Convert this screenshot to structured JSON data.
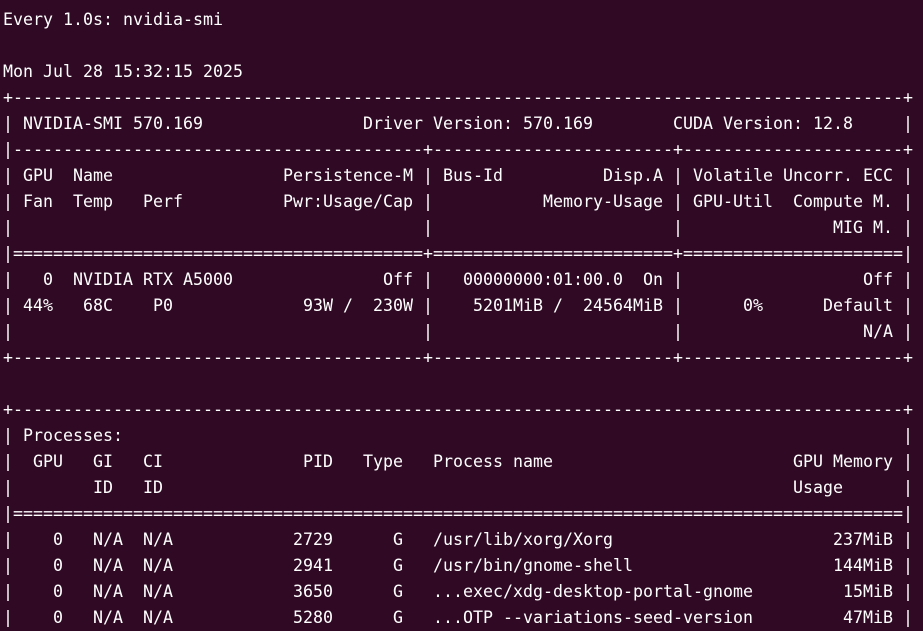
{
  "window": {
    "background": "#300a24",
    "foreground": "#ffffff"
  },
  "terminal": {
    "lines": [
      "Every 1.0s: nvidia-smi",
      "",
      "Mon Jul 28 15:32:15 2025",
      "+-----------------------------------------------------------------------------------------+",
      "| NVIDIA-SMI 570.169                Driver Version: 570.169        CUDA Version: 12.8     |",
      "|-----------------------------------------+------------------------+----------------------+",
      "| GPU  Name                 Persistence-M | Bus-Id          Disp.A | Volatile Uncorr. ECC |",
      "| Fan  Temp   Perf          Pwr:Usage/Cap |           Memory-Usage | GPU-Util  Compute M. |",
      "|                                         |                        |               MIG M. |",
      "|=========================================+========================+======================|",
      "|   0  NVIDIA RTX A5000               Off |   00000000:01:00.0  On |                  Off |",
      "| 44%   68C    P0             93W /  230W |    5201MiB /  24564MiB |      0%      Default |",
      "|                                         |                        |                  N/A |",
      "+-----------------------------------------+------------------------+----------------------+",
      "",
      "+-----------------------------------------------------------------------------------------+",
      "| Processes:                                                                              |",
      "|  GPU   GI   CI              PID   Type   Process name                        GPU Memory |",
      "|        ID   ID                                                               Usage      |",
      "|=========================================================================================|",
      "|    0   N/A  N/A            2729      G   /usr/lib/xorg/Xorg                      237MiB |",
      "|    0   N/A  N/A            2941      G   /usr/bin/gnome-shell                    144MiB |",
      "|    0   N/A  N/A            3650      G   ...exec/xdg-desktop-portal-gnome         15MiB |",
      "|    0   N/A  N/A            5280      G   ...OTP --variations-seed-version         47MiB |"
    ]
  }
}
